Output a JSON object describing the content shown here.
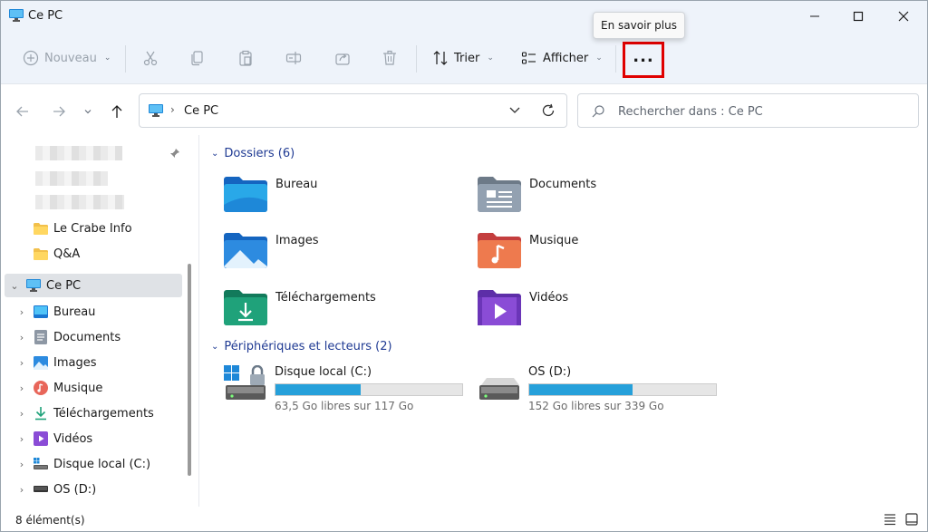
{
  "window": {
    "title": "Ce PC"
  },
  "tooltip": "En savoir plus",
  "toolbar": {
    "new_label": "Nouveau",
    "sort_label": "Trier",
    "view_label": "Afficher",
    "more_label": "..."
  },
  "address": {
    "path": "Ce PC"
  },
  "search": {
    "placeholder": "Rechercher dans : Ce PC"
  },
  "sidebar": {
    "quick_access": [
      {
        "label": "Le Crabe Info",
        "icon": "folder-icon"
      },
      {
        "label": "Q&A",
        "icon": "folder-icon"
      }
    ],
    "this_pc": {
      "label": "Ce PC",
      "icon": "computer-icon"
    },
    "children": [
      {
        "label": "Bureau",
        "icon": "desktop-icon"
      },
      {
        "label": "Documents",
        "icon": "documents-icon"
      },
      {
        "label": "Images",
        "icon": "pictures-icon"
      },
      {
        "label": "Musique",
        "icon": "music-icon"
      },
      {
        "label": "Téléchargements",
        "icon": "downloads-icon"
      },
      {
        "label": "Vidéos",
        "icon": "videos-icon"
      },
      {
        "label": "Disque local (C:)",
        "icon": "drive-c-icon"
      },
      {
        "label": "OS (D:)",
        "icon": "drive-icon"
      }
    ]
  },
  "content": {
    "folders_header": "Dossiers (6)",
    "folders": [
      {
        "name": "Bureau",
        "icon": "desktop-folder-icon"
      },
      {
        "name": "Documents",
        "icon": "documents-folder-icon"
      },
      {
        "name": "Images",
        "icon": "pictures-folder-icon"
      },
      {
        "name": "Musique",
        "icon": "music-folder-icon"
      },
      {
        "name": "Téléchargements",
        "icon": "downloads-folder-icon"
      },
      {
        "name": "Vidéos",
        "icon": "videos-folder-icon"
      }
    ],
    "drives_header": "Périphériques et lecteurs (2)",
    "drives": [
      {
        "name": "Disque local (C:)",
        "free_text": "63,5 Go libres sur 117 Go",
        "used_fraction": 0.457
      },
      {
        "name": "OS (D:)",
        "free_text": "152 Go libres sur 339 Go",
        "used_fraction": 0.552
      }
    ]
  },
  "status": {
    "count": "8 élément(s)"
  },
  "colors": {
    "accent": "#26a0da",
    "highlight": "#e00000",
    "group_header": "#1f3a93"
  }
}
